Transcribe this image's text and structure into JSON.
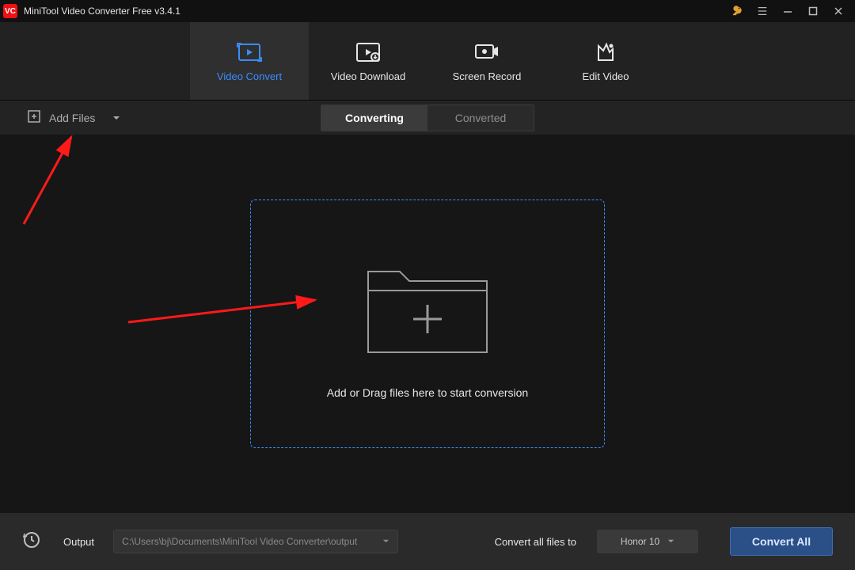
{
  "title": "MiniTool Video Converter Free v3.4.1",
  "nav": {
    "tabs": [
      {
        "label": "Video Convert"
      },
      {
        "label": "Video Download"
      },
      {
        "label": "Screen Record"
      },
      {
        "label": "Edit Video"
      }
    ]
  },
  "toolbar": {
    "add_files_label": "Add Files",
    "seg_converting": "Converting",
    "seg_converted": "Converted"
  },
  "dropzone": {
    "text": "Add or Drag files here to start conversion"
  },
  "bottom": {
    "output_label": "Output",
    "output_path": "C:\\Users\\bj\\Documents\\MiniTool Video Converter\\output",
    "convert_all_to_label": "Convert all files to",
    "preset": "Honor 10",
    "convert_all_button": "Convert All"
  }
}
